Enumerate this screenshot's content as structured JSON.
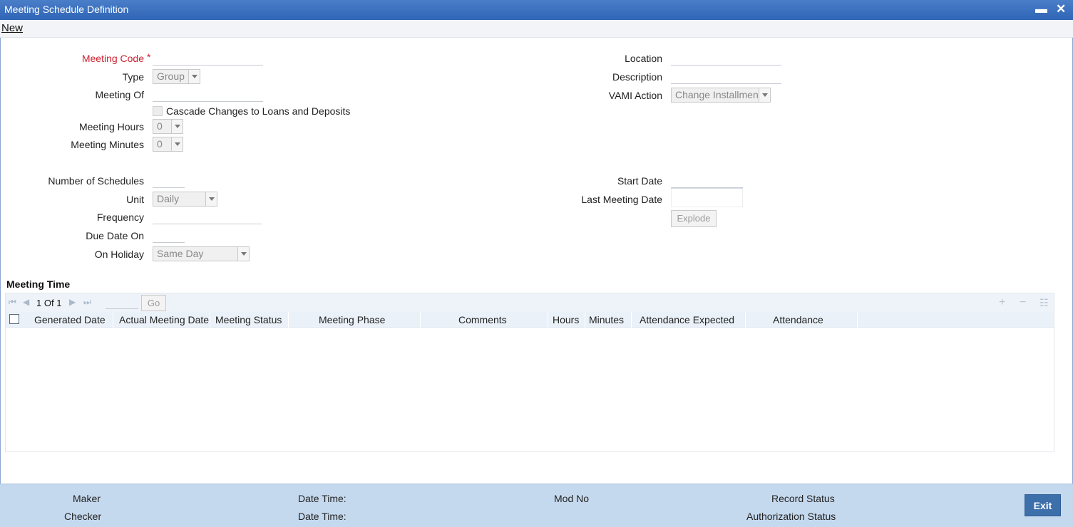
{
  "window": {
    "title": "Meeting Schedule Definition",
    "minimize_glyph": "▬",
    "close_glyph": "✕"
  },
  "menu": {
    "new_label": "New"
  },
  "form": {
    "meeting_code": {
      "label": "Meeting Code",
      "required_mark": "*",
      "value": ""
    },
    "type": {
      "label": "Type",
      "selected": "Group"
    },
    "meeting_of": {
      "label": "Meeting Of",
      "value": ""
    },
    "cascade": {
      "label": "Cascade Changes to Loans and Deposits",
      "checked": false
    },
    "meeting_hours": {
      "label": "Meeting Hours",
      "selected": "0"
    },
    "meeting_minutes": {
      "label": "Meeting Minutes",
      "selected": "0"
    },
    "location": {
      "label": "Location",
      "value": ""
    },
    "description": {
      "label": "Description",
      "value": ""
    },
    "vami_action": {
      "label": "VAMI Action",
      "selected": "Change Installment"
    },
    "number_of_schedules": {
      "label": "Number of Schedules",
      "value": ""
    },
    "unit": {
      "label": "Unit",
      "selected": "Daily"
    },
    "frequency": {
      "label": "Frequency",
      "value": ""
    },
    "due_date_on": {
      "label": "Due Date On",
      "value": ""
    },
    "on_holiday": {
      "label": "On Holiday",
      "selected": "Same Day"
    },
    "start_date": {
      "label": "Start Date",
      "value": ""
    },
    "last_meeting_date": {
      "label": "Last Meeting Date",
      "value": ""
    },
    "explode_label": "Explode"
  },
  "meeting_time": {
    "title": "Meeting Time",
    "pager": {
      "current": "1",
      "of_label": "Of",
      "total": "1",
      "go_label": "Go"
    },
    "toolbar_icons": [
      "add-row-icon",
      "delete-row-icon",
      "single-view-icon"
    ],
    "columns": [
      "Generated Date",
      "Actual Meeting Date",
      "Meeting Status",
      "Meeting Phase",
      "Comments",
      "Hours",
      "Minutes",
      "Attendance Expected",
      "Attendance"
    ],
    "rows": []
  },
  "footer": {
    "maker": "Maker",
    "checker": "Checker",
    "date_time_1": "Date Time:",
    "date_time_2": "Date Time:",
    "mod_no": "Mod No",
    "record_status": "Record Status",
    "authorization_status": "Authorization Status",
    "exit_label": "Exit"
  }
}
